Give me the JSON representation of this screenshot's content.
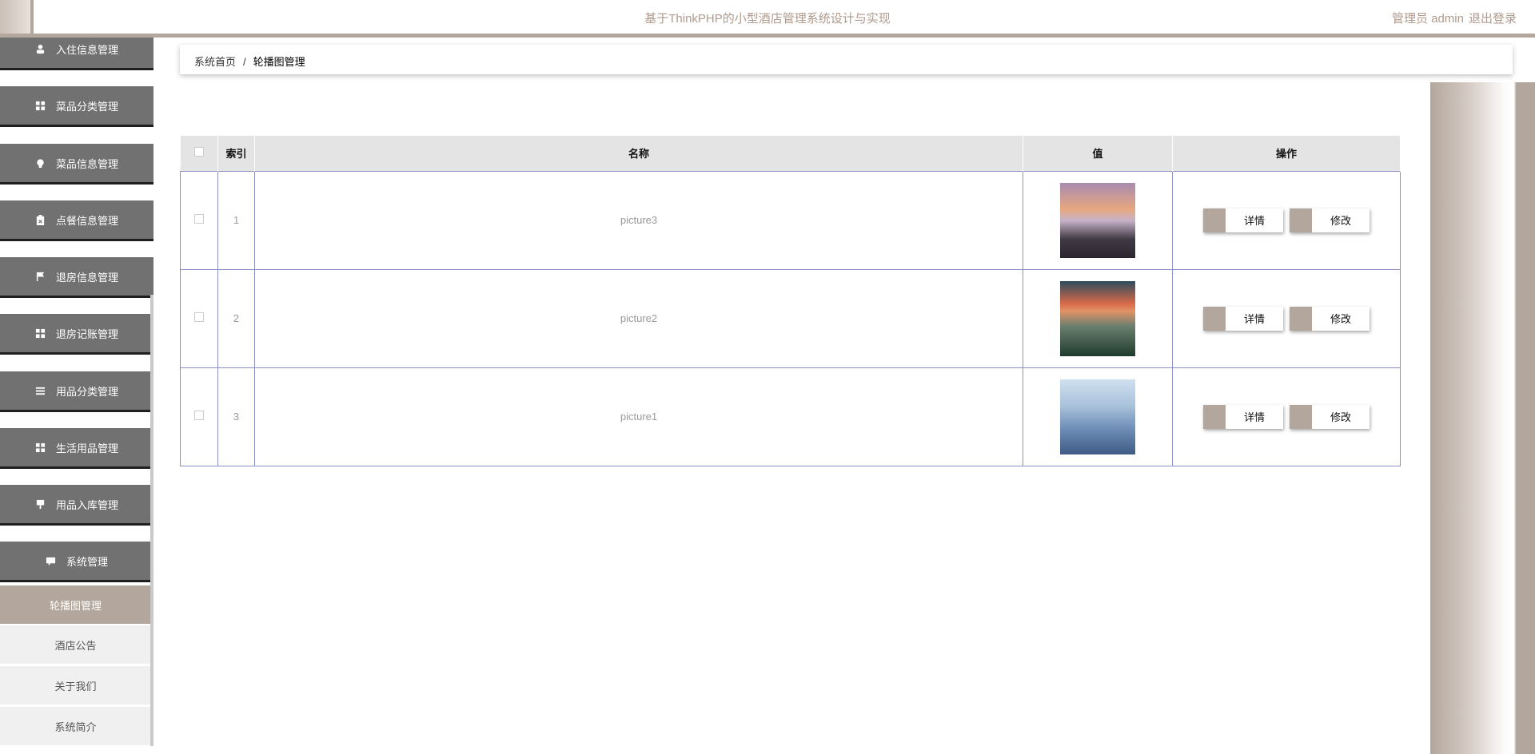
{
  "header": {
    "title": "基于ThinkPHP的小型酒店管理系统设计与实现",
    "role": "管理员 admin",
    "logout": "退出登录"
  },
  "sidebar": {
    "items": [
      {
        "label": "入住信息管理",
        "icon": "user-icon"
      },
      {
        "label": "菜品分类管理",
        "icon": "grid-icon"
      },
      {
        "label": "菜品信息管理",
        "icon": "bulb-icon"
      },
      {
        "label": "点餐信息管理",
        "icon": "clipboard-icon"
      },
      {
        "label": "退房信息管理",
        "icon": "flag-icon"
      },
      {
        "label": "退房记账管理",
        "icon": "grid-icon"
      },
      {
        "label": "用品分类管理",
        "icon": "list-icon"
      },
      {
        "label": "生活用品管理",
        "icon": "grid-icon"
      },
      {
        "label": "用品入库管理",
        "icon": "thumbtack-icon"
      },
      {
        "label": "系统管理",
        "icon": "chat-icon"
      }
    ],
    "sub_items": [
      {
        "label": "轮播图管理",
        "active": true
      },
      {
        "label": "酒店公告",
        "active": false
      },
      {
        "label": "关于我们",
        "active": false
      },
      {
        "label": "系统简介",
        "active": false
      }
    ]
  },
  "breadcrumb": {
    "home": "系统首页",
    "separator": "/",
    "current": "轮播图管理"
  },
  "table": {
    "headers": [
      "",
      "索引",
      "名称",
      "值",
      "操作"
    ],
    "rows": [
      {
        "index": "1",
        "name": "picture3",
        "image": "city-sunset-pink"
      },
      {
        "index": "2",
        "name": "picture2",
        "image": "city-sunset-orange"
      },
      {
        "index": "3",
        "name": "picture1",
        "image": "city-blue-sky"
      }
    ],
    "actions": {
      "detail": "详情",
      "edit": "修改"
    }
  },
  "colors": {
    "accent": "#b3a69c",
    "menu_bg": "#717171",
    "table_border": "#8b8fc4"
  }
}
